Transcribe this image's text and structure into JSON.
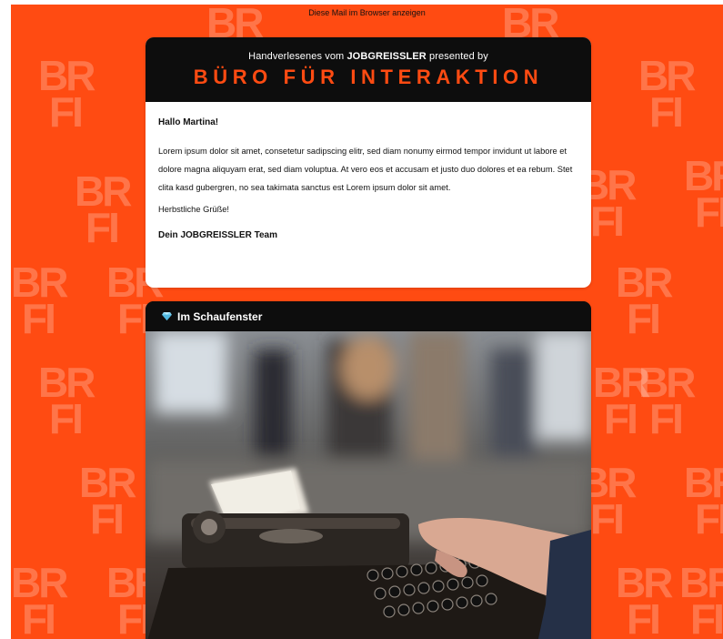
{
  "preheader": {
    "view_in_browser": "Diese Mail im Browser anzeigen"
  },
  "header": {
    "subline_pre": "Handverlesenes vom ",
    "subline_brand": "JOBGREISSLER",
    "subline_post": " presented by",
    "brand_title": "BÜRO FÜR INTERAKTION"
  },
  "greeting": {
    "salutation": "Hallo Martina!",
    "body": "Lorem ipsum dolor sit amet, consetetur sadipscing elitr, sed diam nonumy eirmod tempor invidunt ut labore et dolore magna aliquyam erat, sed diam voluptua. At vero eos et accusam et justo duo dolores et ea rebum. Stet clita kasd gubergren, no sea takimata sanctus est Lorem ipsum dolor sit amet.",
    "closing": "Herbstliche Grüße!",
    "signature": "Dein JOBGREISSLER Team"
  },
  "showcase": {
    "title": "Im Schaufenster",
    "icon": "diamond-icon",
    "image": "typewriter-photo"
  },
  "pattern": {
    "logo_line1": "BR",
    "logo_line2": "FI"
  },
  "colors": {
    "accent": "#ff4b12",
    "header_bg": "#0d0d0d",
    "gem": "#7fd3f2"
  }
}
